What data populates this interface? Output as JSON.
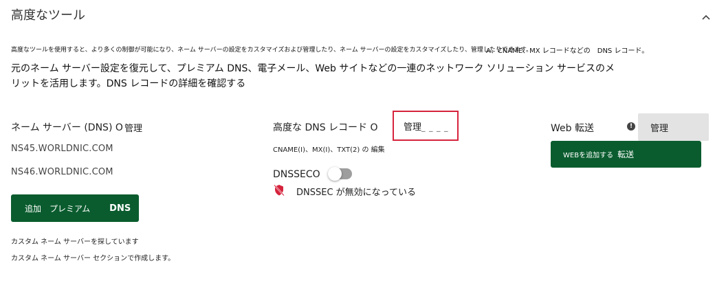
{
  "header": {
    "title": "高度なツール"
  },
  "description": {
    "small_text": "高度なツールを使用すると、より多くの制御が可能になり、ネーム サーバーの設定をカスタマイズおよび管理したり、ネーム サーバーの設定をカスタマイズしたり、管理したりできます。",
    "right_text": "A、CNAME、MX レコードなどの　DNS レコード。",
    "main_text": "元のネーム サーバー設定を復元して、プレミアム DNS、電子メール、Web サイトなどの一連のネットワーク ソリューション サービスのメリットを活用します。DNS レコードの詳細を確認する"
  },
  "nameservers": {
    "label": "ネーム サーバー (DNS) O",
    "manage_label": "管理",
    "ns1": "NS45.WORLDNIC.COM",
    "ns2": "NS46.WORLDNIC.COM",
    "add_button_prefix": "追加　プレミアム",
    "add_button_bold": "DNS",
    "note_line1": "カスタム ネーム サーバーを探しています",
    "note_line2": "カスタム ネーム サーバー セクションで作成します。"
  },
  "advanced_dns": {
    "label": "高度な DNS レコード O",
    "manage_label": "管理",
    "manage_dashes": "_ _ _ _",
    "edit_note": "CNAME(I)、MX(I)、TXT(2) の 編集",
    "dnssec_label": "DNSSECO",
    "dnssec_enabled": false,
    "dnssec_status": "DNSSEC が無効になっている"
  },
  "web_forwarding": {
    "label": "Web 転送",
    "info_icon": "!",
    "manage_label": "管理",
    "add_button_prefix": "WEBを追加する",
    "add_button_suffix": "転送"
  },
  "colors": {
    "primary_green": "#0a5c2e",
    "highlight_red": "#d6233c",
    "gray_button": "#e3e3e3"
  }
}
